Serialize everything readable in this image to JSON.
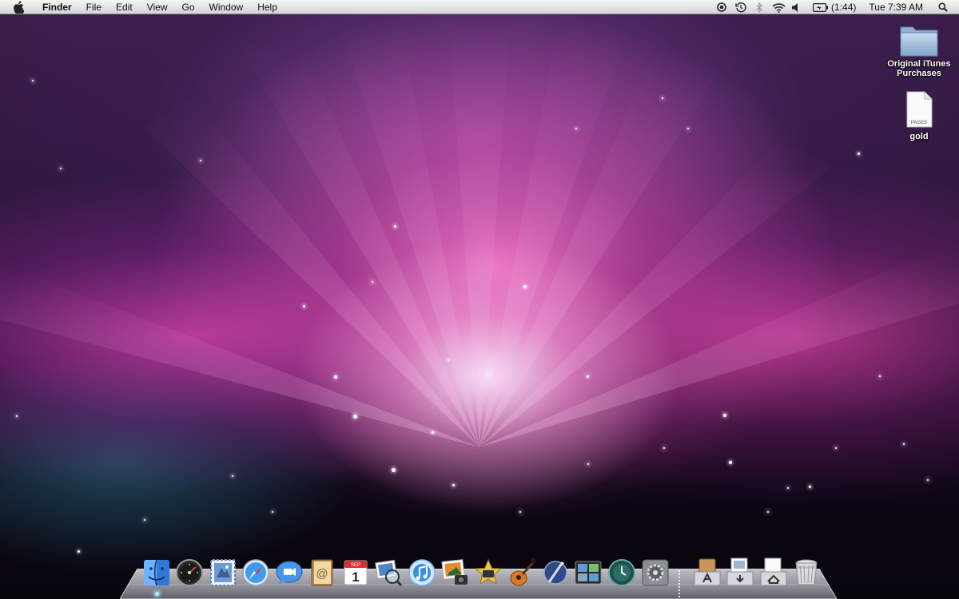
{
  "menubar": {
    "apple_icon": "apple-logo-icon",
    "app_name": "Finder",
    "menus": [
      "File",
      "Edit",
      "View",
      "Go",
      "Window",
      "Help"
    ],
    "status": {
      "icons": [
        "spotlight-status-icon",
        "time-machine-icon",
        "bluetooth-icon",
        "wifi-icon",
        "volume-icon",
        "battery-icon",
        "spotlight-search-icon"
      ],
      "battery_time": "(1:44)",
      "clock": "Tue 7:39 AM"
    }
  },
  "desktop": {
    "wallpaper": "aurora-space",
    "icons": [
      {
        "name": "Original iTunes Purchases",
        "line1": "Original iTunes",
        "line2": "Purchases",
        "type": "folder-icon"
      },
      {
        "name": "gold",
        "type": "pages-document-icon",
        "badge": "PAGES"
      }
    ]
  },
  "dock": {
    "apps": [
      {
        "name": "Finder",
        "icon": "finder-icon",
        "running": true
      },
      {
        "name": "Dashboard",
        "icon": "dashboard-icon"
      },
      {
        "name": "Mail",
        "icon": "mail-icon"
      },
      {
        "name": "Safari",
        "icon": "safari-icon"
      },
      {
        "name": "iChat",
        "icon": "ichat-icon"
      },
      {
        "name": "Address Book",
        "icon": "address-book-icon"
      },
      {
        "name": "iCal",
        "icon": "ical-icon",
        "month": "SEP",
        "day": "1"
      },
      {
        "name": "Preview",
        "icon": "preview-icon"
      },
      {
        "name": "iTunes",
        "icon": "itunes-icon"
      },
      {
        "name": "iPhoto",
        "icon": "iphoto-icon"
      },
      {
        "name": "iMovie",
        "icon": "imovie-icon"
      },
      {
        "name": "GarageBand",
        "icon": "garageband-icon"
      },
      {
        "name": "iWeb",
        "icon": "iweb-icon"
      },
      {
        "name": "Spaces",
        "icon": "spaces-icon"
      },
      {
        "name": "Time Machine",
        "icon": "time-machine-dock-icon"
      },
      {
        "name": "System Preferences",
        "icon": "system-preferences-icon"
      }
    ],
    "stacks": [
      {
        "name": "Applications",
        "icon": "applications-stack-icon"
      },
      {
        "name": "Documents",
        "icon": "documents-stack-icon"
      },
      {
        "name": "Downloads",
        "icon": "downloads-stack-icon"
      }
    ],
    "trash": {
      "name": "Trash",
      "icon": "trash-icon"
    }
  }
}
